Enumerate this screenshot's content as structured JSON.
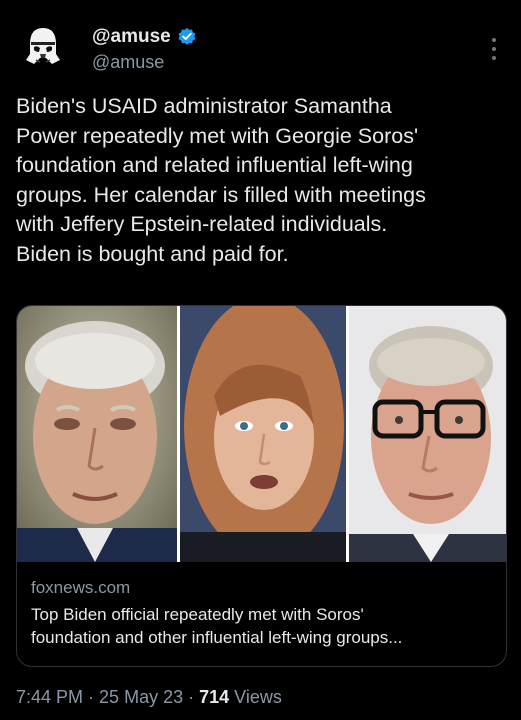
{
  "author": {
    "display_name": "@amuse",
    "handle": "@amuse",
    "verified": true,
    "avatar_icon": "stormtrooper-helmet-icon"
  },
  "tweet": {
    "text": "Biden's USAID administrator Samantha\nPower repeatedly met with Georgie Soros'\nfoundation and related influential left-wing\ngroups. Her calendar is filled with meetings\nwith Jeffery Epstein-related individuals.\nBiden is bought and paid for."
  },
  "card": {
    "domain": "foxnews.com",
    "title": "Top Biden official repeatedly met with Soros'\nfoundation and other influential left-wing groups..."
  },
  "meta": {
    "time": "7:44 PM",
    "separator": "·",
    "date": "25 May 23",
    "views_count": "714",
    "views_label": "Views"
  },
  "colors": {
    "background": "#000000",
    "text_primary": "#e7e9ea",
    "text_secondary": "#8b98a5",
    "verified_blue": "#1d9bf0",
    "border": "#2f3336"
  }
}
